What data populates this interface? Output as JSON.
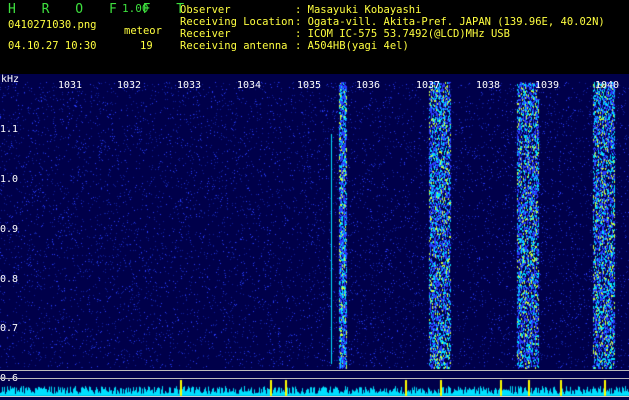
{
  "header": {
    "app_title": "H R O F F T",
    "app_version": "1.00",
    "file_name": "0410271030.png",
    "mode_label": "meteor",
    "datetime": "04.10.27 10:30",
    "count": "19",
    "info_labels": [
      "Observer",
      "Receiving Location",
      "Receiver",
      "Receiving antenna"
    ],
    "info_values": [
      ": Masayuki Kobayashi",
      ": Ogata-vill. Akita-Pref. JAPAN (139.96E, 40.02N)",
      ": ICOM IC-575 53.7492(@LCD)MHz USB",
      ": A504HB(yagi 4el)"
    ]
  },
  "spectrogram": {
    "y_unit": "kHz",
    "time_ticks": [
      "1031",
      "1032",
      "1033",
      "1034",
      "1035",
      "1036",
      "1037",
      "1038",
      "1039",
      "1040"
    ],
    "freq_ticks": [
      "1.1",
      "1.0",
      "0.9",
      "0.8",
      "0.7",
      "0.6"
    ],
    "colors": {
      "background": "#00004a",
      "noise": "#2a3cff",
      "strong": "#00e0ff",
      "peak": "#c8ff40",
      "spike": "#ffff00"
    }
  }
}
